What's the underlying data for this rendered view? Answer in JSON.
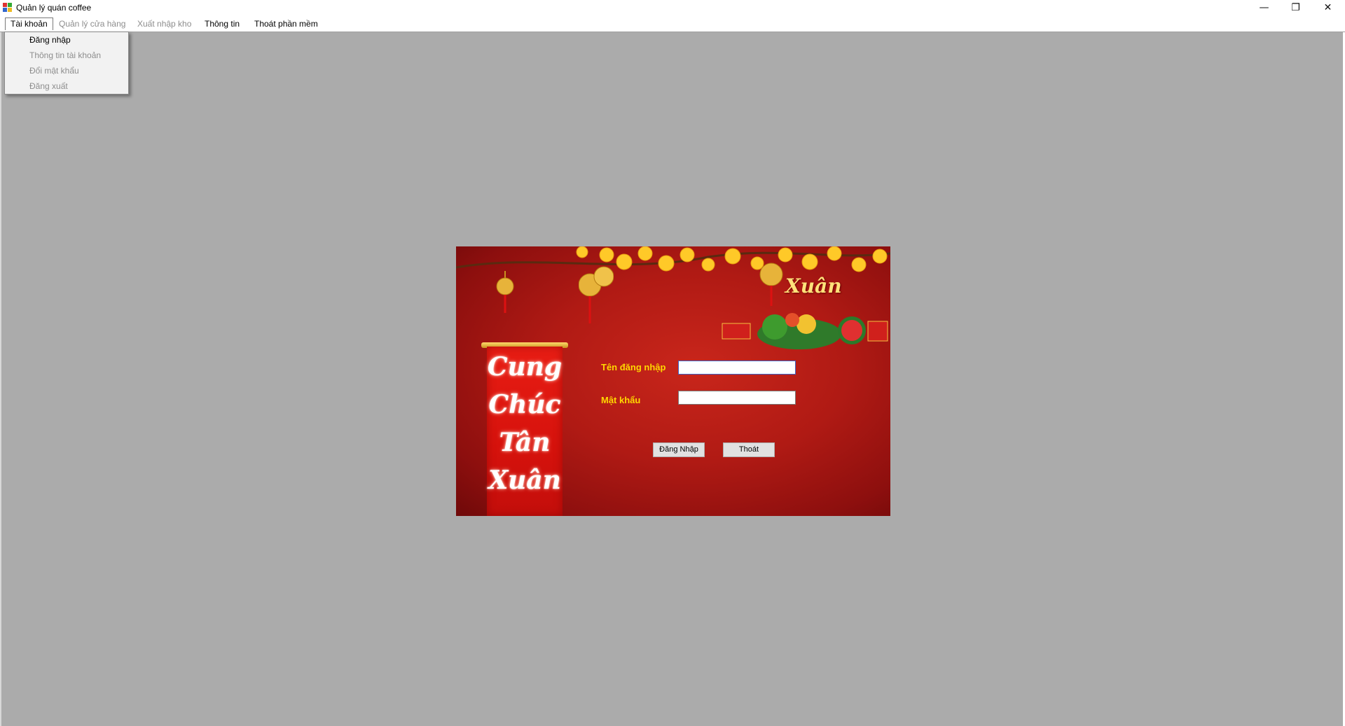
{
  "window": {
    "title": "Quản lý quán coffee",
    "minimize_symbol": "—",
    "maximize_symbol": "❐",
    "close_symbol": "✕"
  },
  "menu": {
    "items": [
      {
        "label": "Tài khoản",
        "enabled": true,
        "open": true
      },
      {
        "label": "Quản lý cửa hàng",
        "enabled": false
      },
      {
        "label": "Xuất nhập kho",
        "enabled": false
      },
      {
        "label": "Thông tin",
        "enabled": true
      },
      {
        "label": "Thoát phần mềm",
        "enabled": true
      }
    ],
    "dropdown": [
      {
        "label": "Đăng nhập",
        "enabled": true
      },
      {
        "label": "Thông tin tài khoản",
        "enabled": false
      },
      {
        "label": "Đổi mật khẩu",
        "enabled": false
      },
      {
        "label": "Đăng xuất",
        "enabled": false
      }
    ]
  },
  "login": {
    "banner_lines": [
      "Cung",
      "Chúc",
      "Tân",
      "Xuân"
    ],
    "corner_word": "Xuân",
    "username_label": "Tên đăng nhập",
    "username_value": "",
    "password_label": "Mật khẩu",
    "password_value": "",
    "login_button": "Đăng Nhập",
    "exit_button": "Thoát"
  },
  "colors": {
    "workspace": "#ababab",
    "panel_red": "#b01a14",
    "label_yellow": "#ffd700",
    "disabled_text": "#8d8d8d"
  }
}
